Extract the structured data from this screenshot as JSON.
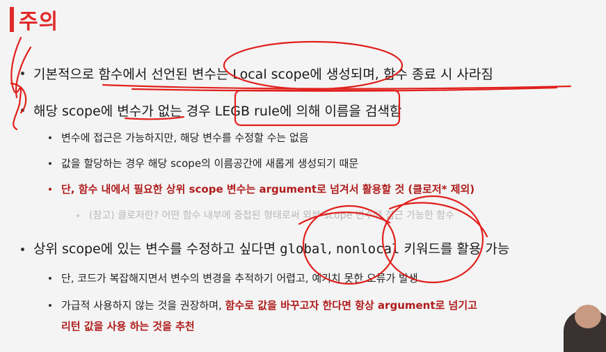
{
  "title": "주의",
  "bullets": {
    "b1": "기본적으로 함수에서 선언된 변수는 Local scope에 생성되며, 함수 종료 시 사라짐",
    "b2": "해당 scope에 변수가 없는 경우 LEGB rule에 의해 이름을 검색함",
    "b2_1": "변수에 접근은 가능하지만, 해당 변수를 수정할 수는 없음",
    "b2_2": "값을 할당하는 경우 해당 scope의 이름공간에 새롭게 생성되기 때문",
    "b2_3": "단, 함수 내에서 필요한 상위 scope 변수는 argument로 넘겨서 활용할 것 (클로저* 제외)",
    "b2_3_1": "(참고) 클로저란? 어떤 함수 내부에 중첩된 형태로써 외부 scope 변수에 접근 가능한 함수",
    "b3_pre": "상위 scope에 있는 변수를 수정하고 싶다면 ",
    "b3_code1": "global",
    "b3_sep": ", ",
    "b3_code2": "nonlocal",
    "b3_post": " 키워드를 활용 가능",
    "b3_1": "단, 코드가 복잡해지면서 변수의 변경을 추적하기 어렵고, 예기치 못한 오류가 발생",
    "b3_2_pre": "가급적 사용하지 않는 것을 권장하며, ",
    "b3_2_red": "함수로 값을 바꾸고자 한다면 항상 argument로 넘기고",
    "b3_2_red2": "리턴 값을 사용 하는 것을 추천"
  },
  "colors": {
    "accent": "#e02a2a",
    "emphasis": "#b01c1c",
    "ink": "#e0201c"
  }
}
